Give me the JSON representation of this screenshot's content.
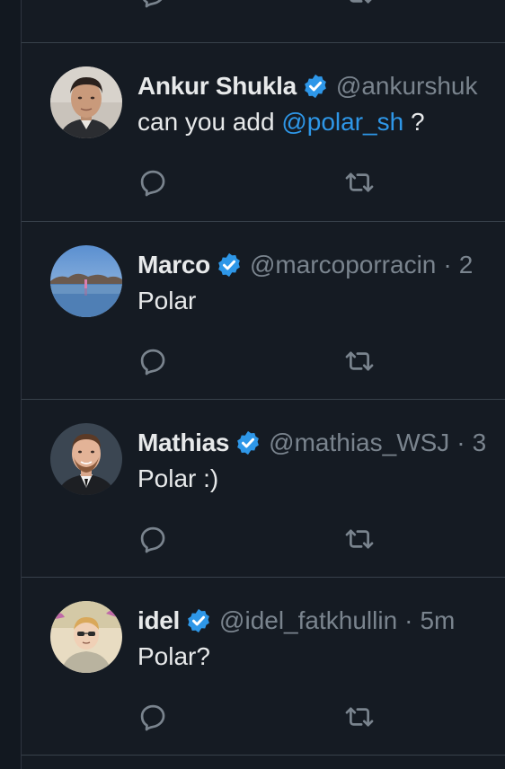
{
  "tweets": [
    {
      "display_name": "Ankur Shukla",
      "handle": "@ankurshuk",
      "text_before": "can you add ",
      "mention": "@polar_sh",
      "text_after": " ?"
    },
    {
      "display_name": "Marco",
      "handle": "@marcoporracin",
      "separator": "·",
      "time": "2",
      "text": "Polar"
    },
    {
      "display_name": "Mathias",
      "handle": "@mathias_WSJ",
      "separator": "·",
      "time": "3",
      "text": "Polar :)"
    },
    {
      "display_name": "idel",
      "handle": "@idel_fatkhullin",
      "separator": "·",
      "time": "5m",
      "text": "Polar?"
    }
  ],
  "colors": {
    "background": "#151b23",
    "text": "#e7e9ea",
    "secondary_text": "#7a848e",
    "link": "#2e97e8",
    "verified_badge": "#2e97e8",
    "divider": "#38414b"
  },
  "icons": {
    "verified": "verified-badge-icon",
    "reply": "reply-icon",
    "retweet": "retweet-icon"
  }
}
